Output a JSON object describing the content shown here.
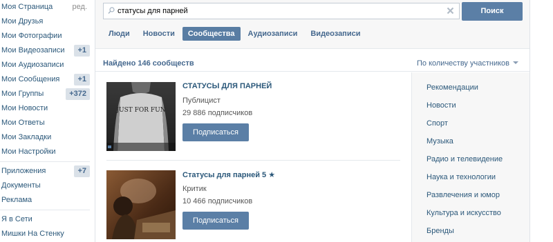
{
  "sidebar": {
    "items": [
      {
        "label": "Моя Страница",
        "edit": "ред."
      },
      {
        "label": "Мои Друзья"
      },
      {
        "label": "Мои Фотографии"
      },
      {
        "label": "Мои Видеозаписи",
        "badge": "+1"
      },
      {
        "label": "Мои Аудиозаписи"
      },
      {
        "label": "Мои Сообщения",
        "badge": "+1"
      },
      {
        "label": "Мои Группы",
        "badge": "+372"
      },
      {
        "label": "Мои Новости"
      },
      {
        "label": "Мои Ответы"
      },
      {
        "label": "Мои Закладки"
      },
      {
        "label": "Мои Настройки"
      }
    ],
    "items2": [
      {
        "label": "Приложения",
        "badge": "+7"
      },
      {
        "label": "Документы"
      },
      {
        "label": "Реклама"
      }
    ],
    "items3": [
      {
        "label": "Я в Сети"
      },
      {
        "label": "Мишки На Стенку"
      }
    ]
  },
  "search": {
    "value": "статусы для парней",
    "button_label": "Поиск"
  },
  "tabs": [
    {
      "label": "Люди",
      "active": false
    },
    {
      "label": "Новости",
      "active": false
    },
    {
      "label": "Сообщества",
      "active": true
    },
    {
      "label": "Аудиозаписи",
      "active": false
    },
    {
      "label": "Видеозаписи",
      "active": false
    }
  ],
  "summary": {
    "found": "Найдено 146 сообществ",
    "sort": "По количеству участников"
  },
  "results": [
    {
      "name": "СТАТУСЫ ДЛЯ ПАРНЕЙ",
      "type": "Публицист",
      "subscribers": "29 886 подписчиков",
      "button": "Подписаться",
      "thumb_text": "JUST FOR FUN"
    },
    {
      "name": "Статусы для парней 5 ★",
      "type": "Критик",
      "subscribers": "10 466 подписчиков",
      "button": "Подписаться"
    }
  ],
  "categories": [
    "Рекомендации",
    "Новости",
    "Спорт",
    "Музыка",
    "Радио и телевидение",
    "Наука и технологии",
    "Развлечения и юмор",
    "Культура и искусство",
    "Бренды"
  ],
  "colors": {
    "link": "#2b587a",
    "accent": "#5b7fa6",
    "badge_bg": "#dae1e8",
    "panel_bg": "#f7f7f7"
  },
  "icons": {
    "search": "magnifier-icon",
    "clear": "close-icon",
    "sort": "triangle-down-icon"
  }
}
